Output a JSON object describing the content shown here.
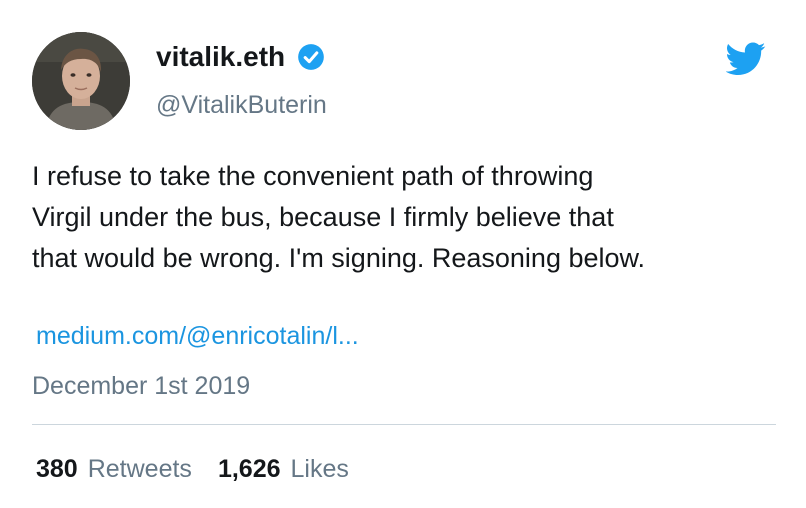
{
  "user": {
    "display_name": "vitalik.eth",
    "handle": "@VitalikButerin",
    "avatar_icon": "user-avatar-photo",
    "verified_icon": "verified-badge-icon",
    "verified_color": "#1da1f2"
  },
  "brand": {
    "icon": "twitter-bird-icon",
    "color": "#1da1f2"
  },
  "tweet": {
    "text_lines": [
      "I refuse to take the convenient path of throwing",
      "Virgil under the bus, because I firmly believe that",
      "that would be wrong. I'm signing. Reasoning below."
    ],
    "link_text": "medium.com/@enricotalin/l...",
    "link_color": "#1b95e0",
    "date": "December 1st 2019"
  },
  "stats": {
    "retweets_count": "380",
    "retweets_label": "Retweets",
    "likes_count": "1,626",
    "likes_label": "Likes"
  }
}
